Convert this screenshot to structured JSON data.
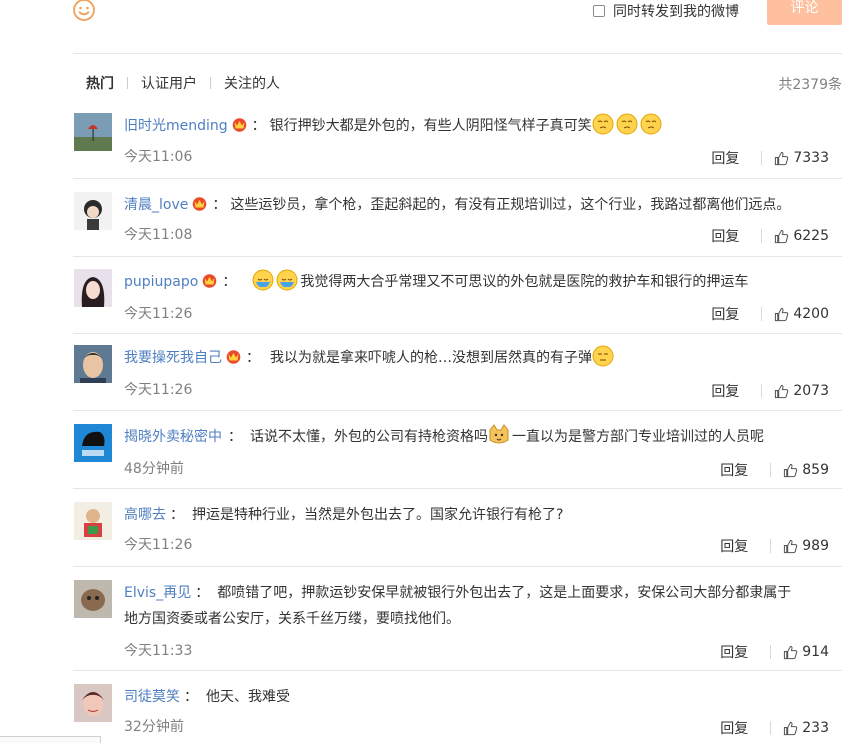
{
  "composer": {
    "repost_label": "同时转发到我的微博",
    "submit_label": "评论"
  },
  "tabs": [
    {
      "label": "热门",
      "active": true
    },
    {
      "label": "认证用户",
      "active": false
    },
    {
      "label": "关注的人",
      "active": false
    }
  ],
  "total_count": "共2379条",
  "actions": {
    "reply_label": "回复"
  },
  "comments": [
    {
      "user": "旧时光mending",
      "crown": true,
      "text": "银行押钞大都是外包的，有些人阴阳怪气样子真可笑",
      "emojis_after": 3,
      "time": "今天11:06",
      "likes": "7333"
    },
    {
      "user": "清晨_love",
      "crown": true,
      "text": "这些运钞员，拿个枪，歪起斜起的，有没有正规培训过，这个行业，我路过都离他们远点。",
      "time": "今天11:08",
      "likes": "6225"
    },
    {
      "user": "pupiupapo",
      "crown": true,
      "text": "我觉得两大合乎常理又不可思议的外包就是医院的救护车和银行的押运车",
      "time": "今天11:26",
      "likes": "4200"
    },
    {
      "user": "我要操死我自己",
      "crown": true,
      "text": "我以为就是拿来吓唬人的枪…没想到居然真的有子弹",
      "time": "今天11:26",
      "likes": "2073"
    },
    {
      "user": "揭晓外卖秘密中",
      "crown": false,
      "text_a": "话说不太懂，外包的公司有持枪资格吗",
      "text_b": "一直以为是警方部门专业培训过的人员呢",
      "time": "48分钟前",
      "likes": "859"
    },
    {
      "user": "高哪去",
      "crown": false,
      "text": "押运是特种行业，当然是外包出去了。国家允许银行有枪了?",
      "time": "今天11:26",
      "likes": "989"
    },
    {
      "user": "Elvis_再见",
      "crown": false,
      "text_line1": "都喷错了吧，押款运钞安保早就被银行外包出去了，这是上面要求，安保公司大部分都隶属于",
      "text_line2": "地方国资委或者公安厅，关系千丝万缕，要喷找他们。",
      "time": "今天11:33",
      "likes": "914"
    },
    {
      "user": "司徒莫笑",
      "crown": false,
      "text": "他天、我难受",
      "time": "32分钟前",
      "likes": "233"
    }
  ],
  "colors": {
    "link_blue": "#4f7fc2",
    "submit_disabled": "#ffc09f",
    "meta_gray": "#808080"
  },
  "icons": [
    "smiley-icon",
    "crown-icon",
    "like-icon",
    "emoji-icon"
  ]
}
